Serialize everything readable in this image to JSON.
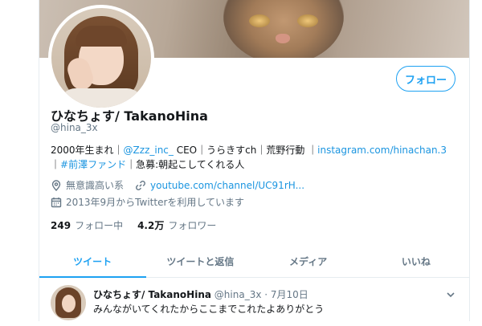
{
  "profile": {
    "display_name": "ひなちょす/ TakanoHina",
    "handle": "@hina_3x",
    "follow_button": "フォロー",
    "bio": {
      "line1_a": "2000年生まれ｜",
      "line1_mention": "@Zzz_inc_",
      "line1_b": " CEO｜うらきすch｜荒野行動 ｜",
      "line1_link": "instagram.com/hinachan.3",
      "line2_a": "｜",
      "line2_hashtag": "#前澤ファンド",
      "line2_b": "｜急募:朝起こしてくれる人"
    },
    "location": "無意識高い系",
    "website": "youtube.com/channel/UC91rH...",
    "joined": "2013年9月からTwitterを利用しています",
    "following_count": "249",
    "following_label": "フォロー中",
    "followers_count": "4.2万",
    "followers_label": "フォロワー"
  },
  "tabs": [
    {
      "label": "ツイート",
      "active": true
    },
    {
      "label": "ツイートと返信",
      "active": false
    },
    {
      "label": "メディア",
      "active": false
    },
    {
      "label": "いいね",
      "active": false
    }
  ],
  "tweet": {
    "name": "ひなちょす/ TakanoHina",
    "handle": "@hina_3x",
    "separator": " · ",
    "date": "7月10日",
    "text": "みんながいてくれたからここまでこれたよありがとう"
  },
  "colors": {
    "accent": "#1da1f2",
    "link": "#1b95e0",
    "muted": "#657786",
    "text": "#14171a",
    "border": "#e6ecf0"
  },
  "icons": {
    "location": "location-pin-icon",
    "website": "link-icon",
    "joined": "calendar-icon",
    "tweet_menu": "chevron-down-icon"
  }
}
